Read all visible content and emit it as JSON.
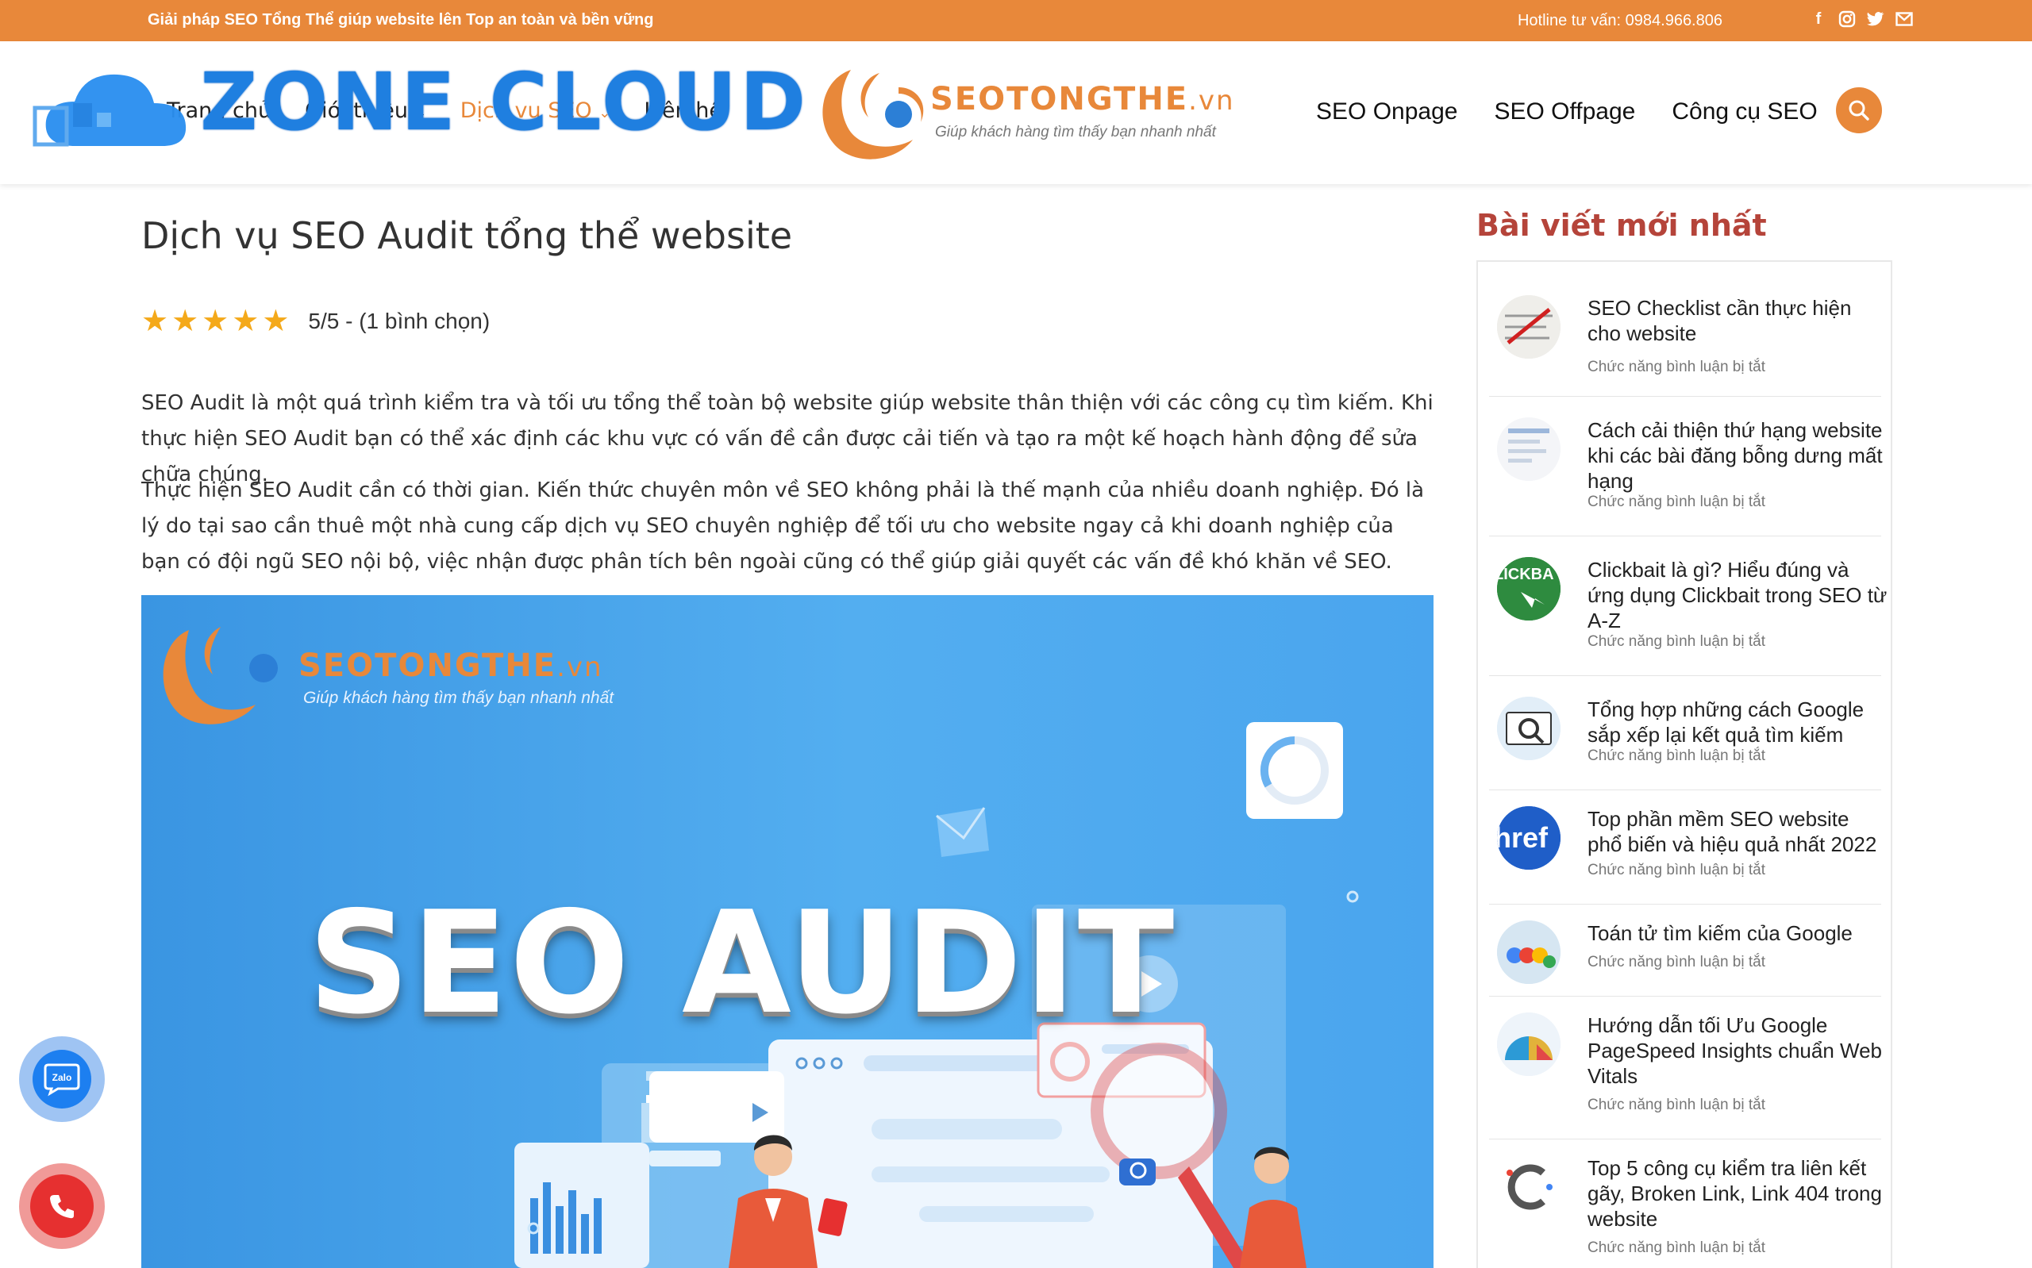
{
  "topbar": {
    "tagline": "Giải pháp SEO Tổng Thể giúp website lên Top an toàn và bền vững",
    "hotline": "Hotline tư vấn: 0984.966.806",
    "social_icons": [
      "facebook-icon",
      "instagram-icon",
      "twitter-icon",
      "email-icon"
    ]
  },
  "header": {
    "watermark": "ZONE CLOUD",
    "left_nav": [
      "Trang chủ",
      "Giới thiệu",
      "Dịch vụ SEO",
      "Liên hệ"
    ],
    "brand": {
      "name": "SEOTONGTHE",
      "suffix": ".vn",
      "slogan": "Giúp khách hàng tìm thấy bạn nhanh nhất"
    },
    "right_nav": [
      "SEO Onpage",
      "SEO Offpage",
      "Công cụ SEO"
    ]
  },
  "article": {
    "title": "Dịch vụ SEO Audit tổng thể website",
    "rating": {
      "value": 5,
      "max": 5,
      "text": "5/5 - (1 bình chọn)"
    },
    "paragraphs": [
      "SEO Audit là một quá trình kiểm tra và tối ưu tổng thể toàn bộ website giúp website thân thiện với các công cụ tìm kiếm. Khi thực hiện SEO Audit bạn có thể xác định các khu vực có vấn đề cần được cải tiến và tạo ra một kế hoạch hành động để sửa chữa chúng.",
      "Thực hiện SEO Audit cần có thời gian. Kiến thức chuyên môn về SEO không phải là thế mạnh của nhiều doanh nghiệp. Đó là lý do tại sao cần thuê một nhà cung cấp dịch vụ SEO chuyên nghiệp để tối ưu cho website ngay cả khi doanh nghiệp của bạn có đội ngũ SEO nội bộ, việc nhận được phân tích bên ngoài cũng có thể giúp giải quyết các vấn đề khó khăn về SEO."
    ],
    "banner": {
      "brand": "SEOTONGTHE",
      "suffix": ".vn",
      "slogan": "Giúp khách hàng tìm thấy bạn nhanh nhất",
      "title": "SEO AUDIT"
    }
  },
  "sidebar": {
    "heading": "Bài viết mới nhất",
    "posts": [
      {
        "title": "SEO Checklist cần thực hiện cho website",
        "meta": "Chức năng bình luận bị tắt"
      },
      {
        "title": "Cách cải thiện thứ hạng website khi các bài đăng bỗng dưng mất hạng",
        "meta": "Chức năng bình luận bị tắt"
      },
      {
        "title": "Clickbait là gì? Hiểu đúng và ứng dụng Clickbait trong SEO từ A-Z",
        "meta": "Chức năng bình luận bị tắt"
      },
      {
        "title": "Tổng hợp những cách Google sắp xếp lại kết quả tìm kiếm",
        "meta": "Chức năng bình luận bị tắt"
      },
      {
        "title": "Top phần mềm SEO website phổ biến và hiệu quả nhất 2022",
        "meta": "Chức năng bình luận bị tắt"
      },
      {
        "title": "Toán tử tìm kiếm của Google",
        "meta": "Chức năng bình luận bị tắt"
      },
      {
        "title": "Hướng dẫn tối Ưu Google PageSpeed Insights chuẩn Web Vitals",
        "meta": "Chức năng bình luận bị tắt"
      },
      {
        "title": "Top 5 công cụ kiểm tra liên kết gãy, Broken Link, Link 404 trong website",
        "meta": "Chức năng bình luận bị tắt"
      }
    ],
    "thumb_labels": [
      "LICKBA",
      "href"
    ]
  },
  "floating": {
    "zalo_label": "Zalo"
  }
}
